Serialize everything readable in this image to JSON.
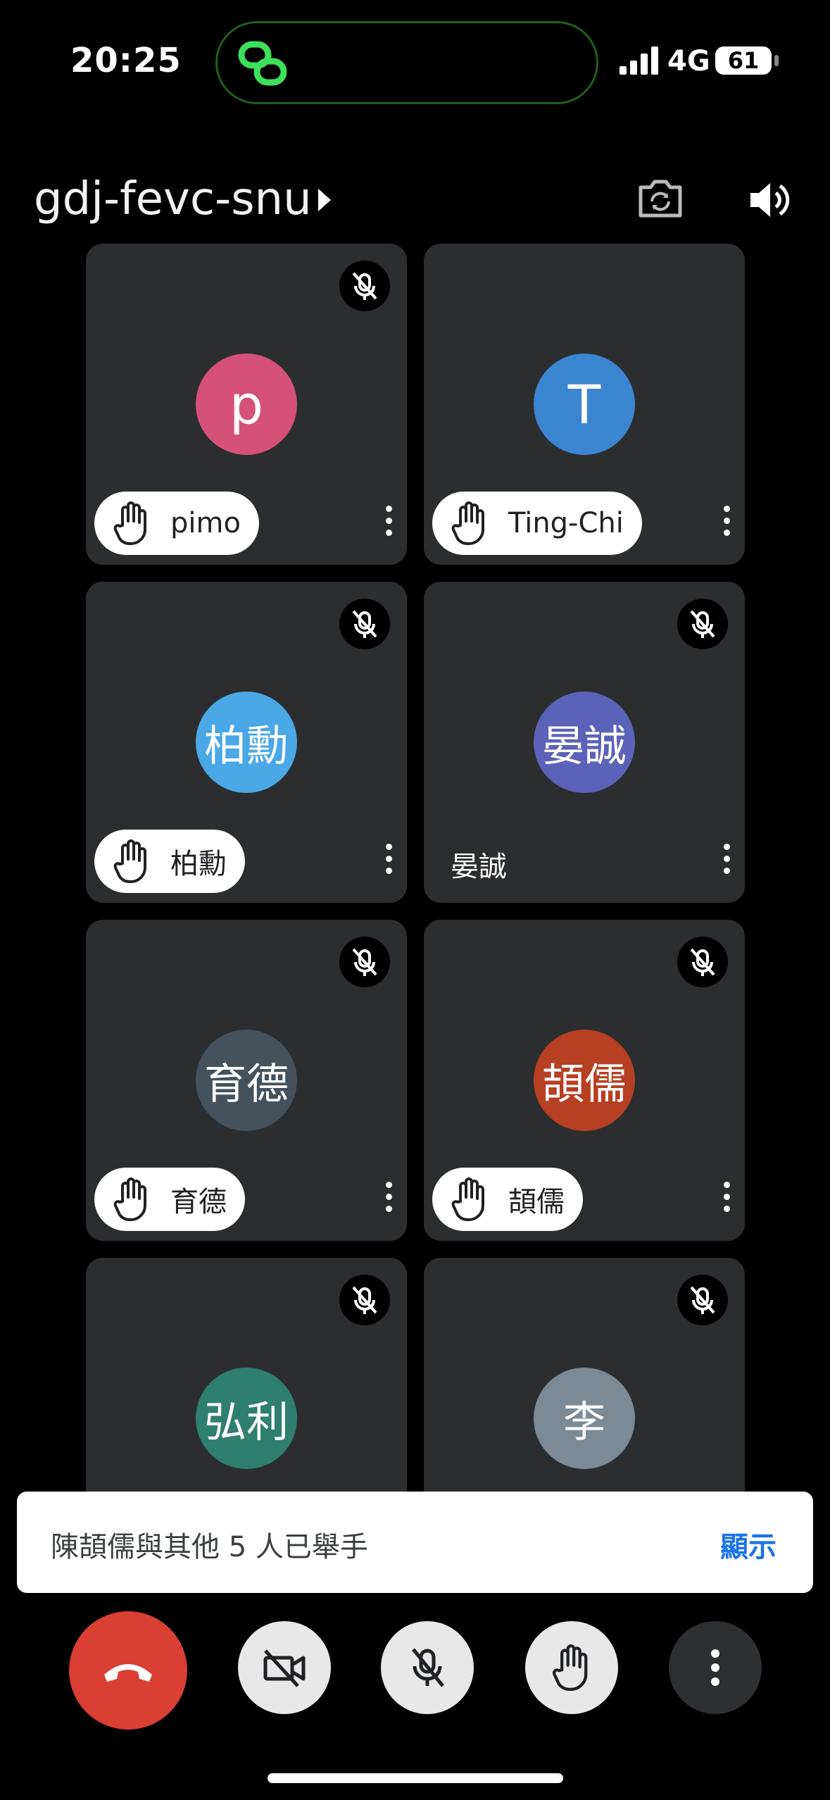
{
  "status": {
    "time": "20:25",
    "network": "4G",
    "battery": "61",
    "signal_icon": "cellular-signal-icon"
  },
  "meeting": {
    "code": "gdj-fevc-snu"
  },
  "participants": [
    {
      "name": "pimo",
      "initial": "p",
      "color": "#d6517a",
      "hand_raised": true,
      "muted": true
    },
    {
      "name": "Ting-Chi",
      "initial": "T",
      "color": "#3c85d0",
      "hand_raised": true,
      "muted": false
    },
    {
      "name": "柏勳",
      "initial": "柏勳",
      "color": "#4aa8e6",
      "hand_raised": true,
      "muted": true
    },
    {
      "name": "晏誠",
      "initial": "晏誠",
      "color": "#5b63b8",
      "hand_raised": false,
      "muted": true
    },
    {
      "name": "育德",
      "initial": "育德",
      "color": "#44525e",
      "hand_raised": true,
      "muted": true
    },
    {
      "name": "頡儒",
      "initial": "頡儒",
      "color": "#b73f22",
      "hand_raised": true,
      "muted": true
    },
    {
      "name": "弘利",
      "initial": "弘利",
      "color": "#2f7f6e",
      "hand_raised": false,
      "muted": true
    },
    {
      "name": "李",
      "initial": "李",
      "color": "#7a8a97",
      "hand_raised": false,
      "muted": true
    }
  ],
  "notification": {
    "text": "陳頡儒與其他 5 人已舉手",
    "action": "顯示"
  },
  "colors": {
    "end_call": "#d93f33",
    "accent": "#1a73e8",
    "tile_bg": "#2c2d2f"
  }
}
